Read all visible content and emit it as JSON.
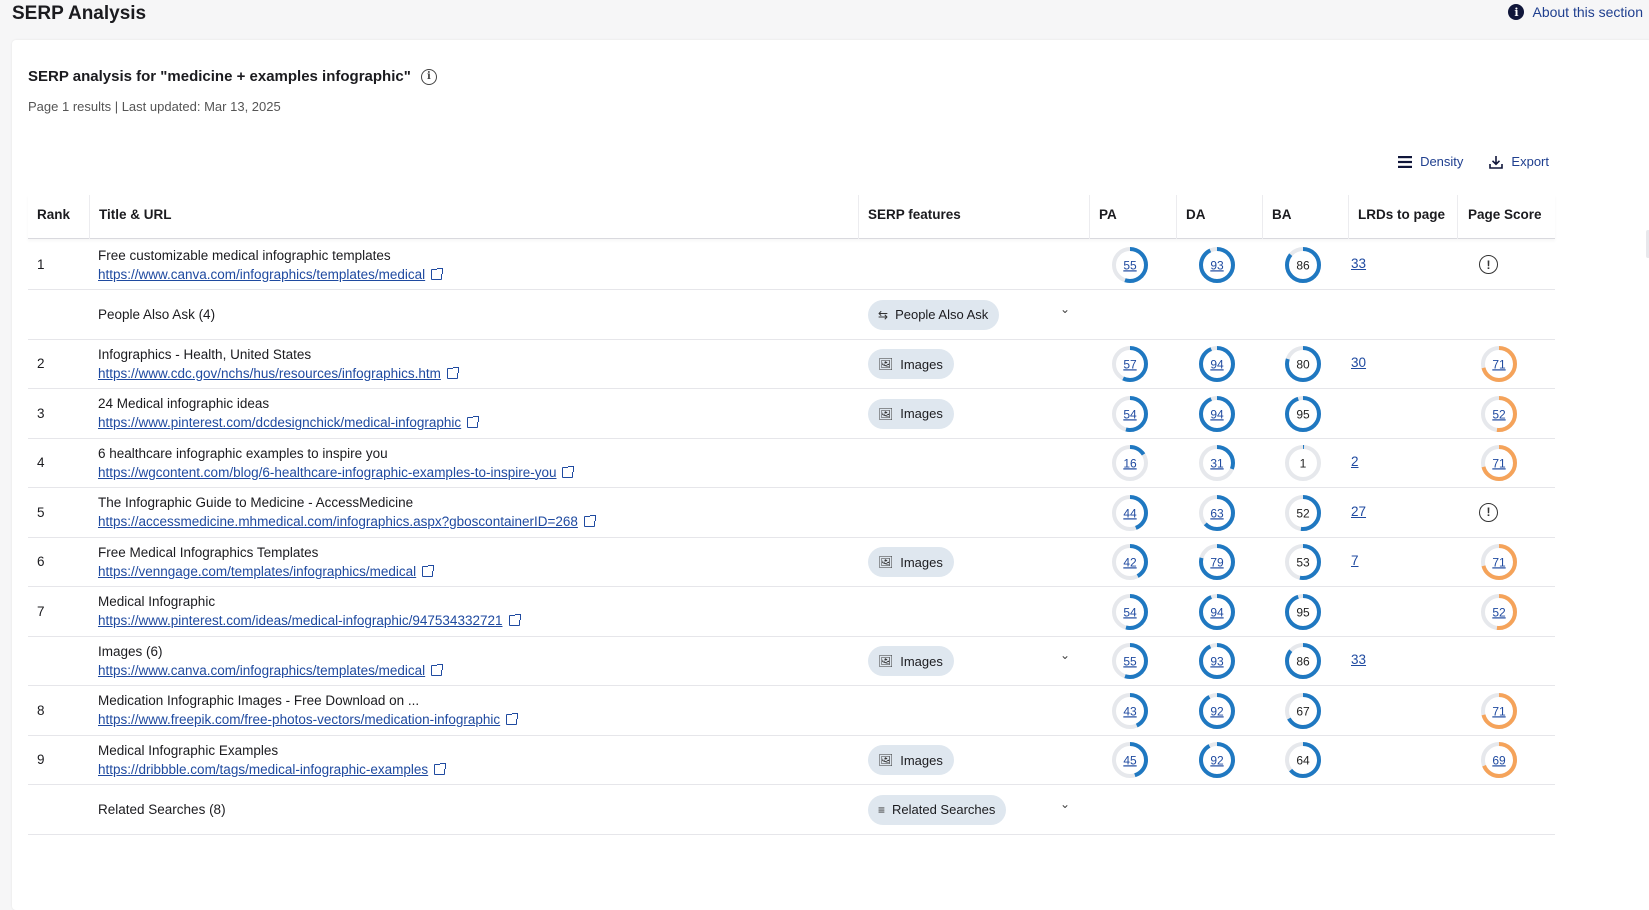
{
  "page": {
    "title": "SERP Analysis",
    "about_label": "About this section"
  },
  "card": {
    "title": "SERP analysis for \"medicine + examples infographic\"",
    "meta": "Page 1 results | Last updated: Mar 13, 2025",
    "density_label": "Density",
    "export_label": "Export"
  },
  "columns": {
    "rank": "Rank",
    "title_url": "Title & URL",
    "serp_features": "SERP features",
    "pa": "PA",
    "da": "DA",
    "ba": "BA",
    "lrds": "LRDs to page",
    "page_score": "Page Score"
  },
  "colors": {
    "blue_arc": "#1f78c1",
    "orange_arc": "#f5a35a",
    "track": "#e6e8ec",
    "link": "#1f4aa0"
  },
  "rows": [
    {
      "rank": "1",
      "title": "Free customizable medical infographic templates",
      "url": "https://www.canva.com/infographics/templates/medical",
      "feature": "",
      "pa": 55,
      "da": 93,
      "ba": 86,
      "lrds": "33",
      "score": null
    },
    {
      "rank": "",
      "title": "People Also Ask (4)",
      "url": "",
      "feature": "People Also Ask",
      "feature_icon": "swap-icon",
      "expandable": true,
      "pa": null,
      "da": null,
      "ba": null,
      "lrds": "",
      "score": "none"
    },
    {
      "rank": "2",
      "title": "Infographics - Health, United States",
      "url": "https://www.cdc.gov/nchs/hus/resources/infographics.htm",
      "feature": "Images",
      "feature_icon": "image-icon",
      "pa": 57,
      "da": 94,
      "ba": 80,
      "lrds": "30",
      "score": 71
    },
    {
      "rank": "3",
      "title": "24 Medical infographic ideas",
      "url": "https://www.pinterest.com/dcdesignchick/medical-infographic",
      "feature": "Images",
      "feature_icon": "image-icon",
      "pa": 54,
      "da": 94,
      "ba": 95,
      "lrds": "",
      "score": 52
    },
    {
      "rank": "4",
      "title": "6 healthcare infographic examples to inspire you",
      "url": "https://wgcontent.com/blog/6-healthcare-infographic-examples-to-inspire-you",
      "feature": "",
      "pa": 16,
      "da": 31,
      "ba": 1,
      "lrds": "2",
      "score": 71
    },
    {
      "rank": "5",
      "title": "The Infographic Guide to Medicine - AccessMedicine",
      "url": "https://accessmedicine.mhmedical.com/infographics.aspx?gboscontainerID=268",
      "feature": "",
      "pa": 44,
      "da": 63,
      "ba": 52,
      "lrds": "27",
      "score": null
    },
    {
      "rank": "6",
      "title": "Free Medical Infographics Templates",
      "url": "https://venngage.com/templates/infographics/medical",
      "feature": "Images",
      "feature_icon": "image-icon",
      "pa": 42,
      "da": 79,
      "ba": 53,
      "lrds": "7",
      "score": 71
    },
    {
      "rank": "7",
      "title": "Medical Infographic",
      "url": "https://www.pinterest.com/ideas/medical-infographic/947534332721",
      "feature": "",
      "pa": 54,
      "da": 94,
      "ba": 95,
      "lrds": "",
      "score": 52
    },
    {
      "rank": "",
      "title": "Images (6)",
      "url": "https://www.canva.com/infographics/templates/medical",
      "feature": "Images",
      "feature_icon": "image-icon",
      "expandable": true,
      "pa": 55,
      "da": 93,
      "ba": 86,
      "lrds": "33",
      "score": "none"
    },
    {
      "rank": "8",
      "title": "Medication Infographic Images - Free Download on ...",
      "url": "https://www.freepik.com/free-photos-vectors/medication-infographic",
      "feature": "",
      "pa": 43,
      "da": 92,
      "ba": 67,
      "lrds": "",
      "score": 71
    },
    {
      "rank": "9",
      "title": "Medical Infographic Examples",
      "url": "https://dribbble.com/tags/medical-infographic-examples",
      "feature": "Images",
      "feature_icon": "image-icon",
      "pa": 45,
      "da": 92,
      "ba": 64,
      "lrds": "",
      "score": 69
    },
    {
      "rank": "",
      "title": "Related Searches (8)",
      "url": "",
      "feature": "Related Searches",
      "feature_icon": "search-list-icon",
      "expandable": true,
      "pa": null,
      "da": null,
      "ba": null,
      "lrds": "",
      "score": "none"
    }
  ]
}
